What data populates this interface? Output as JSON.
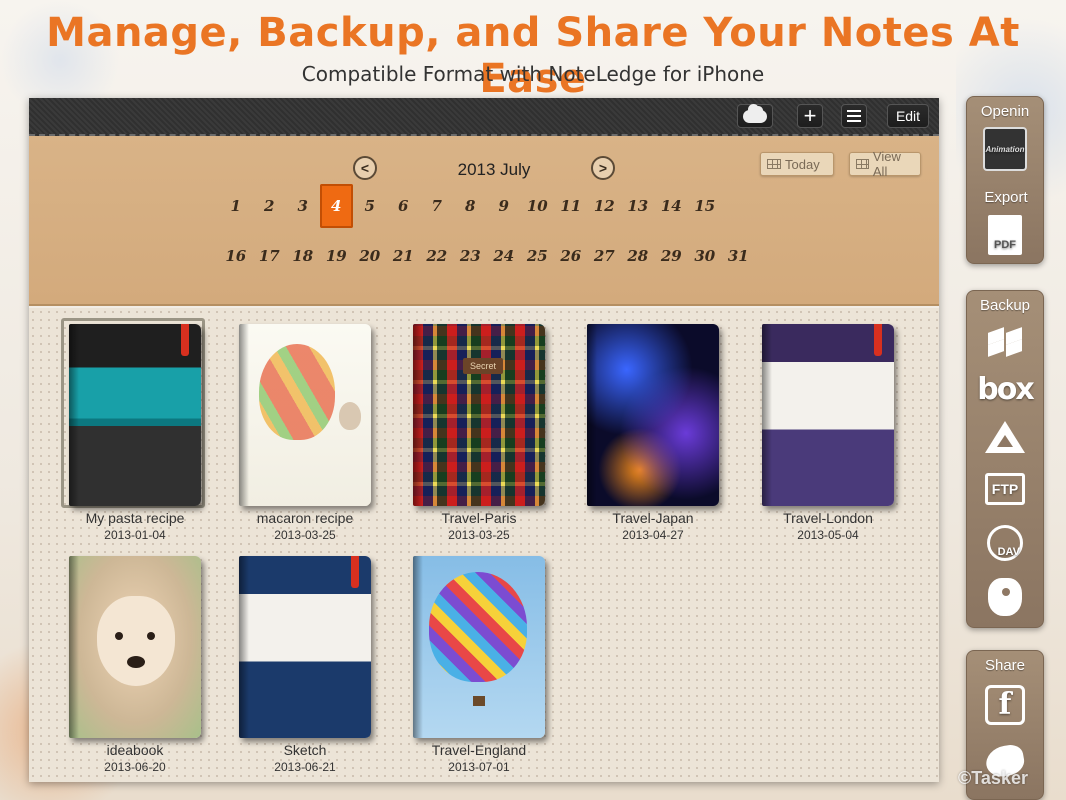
{
  "headline": "Manage, Backup, and Share Your Notes At Ease",
  "subheadline": "Compatible Format with NoteLedge for iPhone",
  "toolbar": {
    "cloud_icon": "cloud-icon",
    "add_label": "+",
    "list_icon": "list-icon",
    "edit_label": "Edit"
  },
  "calendar": {
    "month_title": "2013 July",
    "prev_label": "<",
    "next_label": ">",
    "today_label": "Today",
    "view_all_label": "View All",
    "selected_day": "4",
    "days_row1": [
      "1",
      "2",
      "3",
      "4",
      "5",
      "6",
      "7",
      "8",
      "9",
      "10",
      "11",
      "12",
      "13",
      "14",
      "15"
    ],
    "days_row2": [
      "16",
      "17",
      "18",
      "19",
      "20",
      "21",
      "22",
      "23",
      "24",
      "25",
      "26",
      "27",
      "28",
      "29",
      "30",
      "31"
    ]
  },
  "notebooks": [
    {
      "title": "My pasta recipe",
      "date": "2013-01-04"
    },
    {
      "title": "macaron recipe",
      "date": "2013-03-25"
    },
    {
      "title": "Travel-Paris",
      "date": "2013-03-25",
      "tag": "Secret"
    },
    {
      "title": "Travel-Japan",
      "date": "2013-04-27"
    },
    {
      "title": "Travel-London",
      "date": "2013-05-04"
    },
    {
      "title": "ideabook",
      "date": "2013-06-20"
    },
    {
      "title": "Sketch",
      "date": "2013-06-21"
    },
    {
      "title": "Travel-England",
      "date": "2013-07-01"
    }
  ],
  "sidebar": {
    "openin_label": "Openin",
    "openin_thumb_text": "Animation",
    "export_label": "Export",
    "export_pdf_text": "PDF",
    "backup_label": "Backup",
    "box_text": "box",
    "ftp_text": "FTP",
    "dav_text": "DAV",
    "share_label": "Share",
    "facebook_text": "f"
  },
  "watermark": "©Tasker",
  "colors": {
    "headline": "#ea7524",
    "selected_day": "#ef6a12",
    "sidebar": "#8b7561"
  }
}
